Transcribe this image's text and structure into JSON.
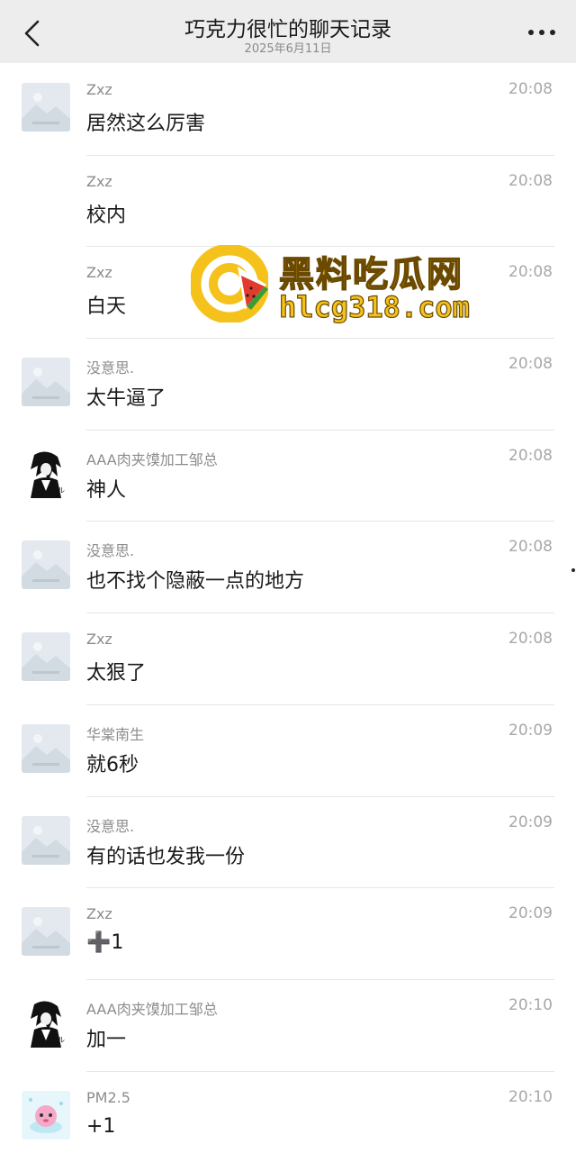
{
  "header": {
    "title": "巧克力很忙的聊天记录",
    "date": "2025年6月11日",
    "back_icon": "chevron-left-icon",
    "more_icon": "more-dots-icon"
  },
  "watermark": {
    "title": "黑料吃瓜网",
    "url": "hlcg318.com"
  },
  "messages": [
    {
      "name": "Zxz",
      "time": "20:08",
      "text": "居然这么厉害",
      "avatar": "placeholder"
    },
    {
      "name": "Zxz",
      "time": "20:08",
      "text": "校内",
      "avatar": "none"
    },
    {
      "name": "Zxz",
      "time": "20:08",
      "text": "白天",
      "avatar": "none"
    },
    {
      "name": "没意思.",
      "time": "20:08",
      "text": "太牛逼了",
      "avatar": "placeholder"
    },
    {
      "name": "AAA肉夹馍加工邹总",
      "time": "20:08",
      "text": "神人",
      "avatar": "manga"
    },
    {
      "name": "没意思.",
      "time": "20:08",
      "text": "也不找个隐蔽一点的地方",
      "avatar": "placeholder"
    },
    {
      "name": "Zxz",
      "time": "20:08",
      "text": "太狠了",
      "avatar": "placeholder"
    },
    {
      "name": "华棠南生",
      "time": "20:09",
      "text": "就6秒",
      "avatar": "placeholder"
    },
    {
      "name": "没意思.",
      "time": "20:09",
      "text": "有的话也发我一份",
      "avatar": "placeholder"
    },
    {
      "name": "Zxz",
      "time": "20:09",
      "text": "➕1",
      "avatar": "placeholder"
    },
    {
      "name": "AAA肉夹馍加工邹总",
      "time": "20:10",
      "text": "加一",
      "avatar": "manga"
    },
    {
      "name": "PM2.5",
      "time": "20:10",
      "text": "+1",
      "avatar": "cartoon"
    }
  ]
}
